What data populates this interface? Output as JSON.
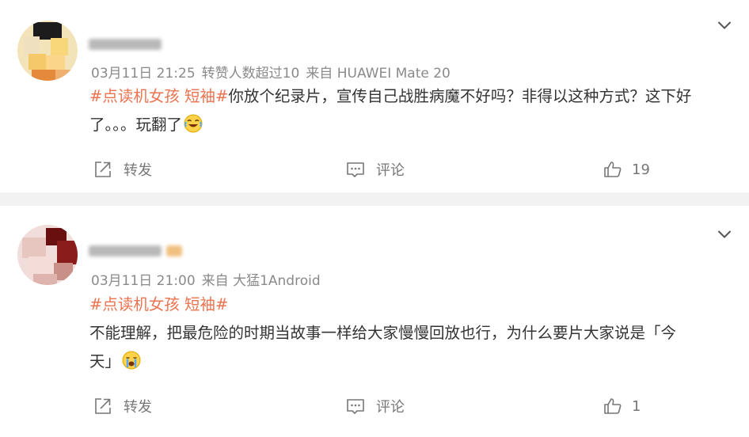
{
  "posts": [
    {
      "meta": {
        "date": "03月11日 21:25",
        "note": "转赞人数超过10",
        "source": "来自 HUAWEI Mate 20"
      },
      "topic": "#点读机女孩 短袖#",
      "text_line1": "你放个纪录片，宣传自己战胜病魔不好吗？非得以这种方式？这下好",
      "text_line2": "了。。。玩翻了",
      "emoji": "laugh-cry-emoji",
      "actions": {
        "repost": "转发",
        "comment": "评论",
        "likes": "19"
      }
    },
    {
      "meta": {
        "date": "03月11日 21:00",
        "note": "",
        "source": "来自 大猛1Android"
      },
      "topic": "#点读机女孩 短袖#",
      "text_line1": "不能理解，把最危险的时期当故事一样给大家慢慢回放也行，为什么要片大家说是「今",
      "text_line2": "天」",
      "emoji": "crying-emoji",
      "actions": {
        "repost": "转发",
        "comment": "评论",
        "likes": "1"
      }
    }
  ],
  "colors": {
    "topic": "#eb7350",
    "meta": "#8a8a8a",
    "body": "#333333",
    "separator": "#f2f2f2"
  }
}
